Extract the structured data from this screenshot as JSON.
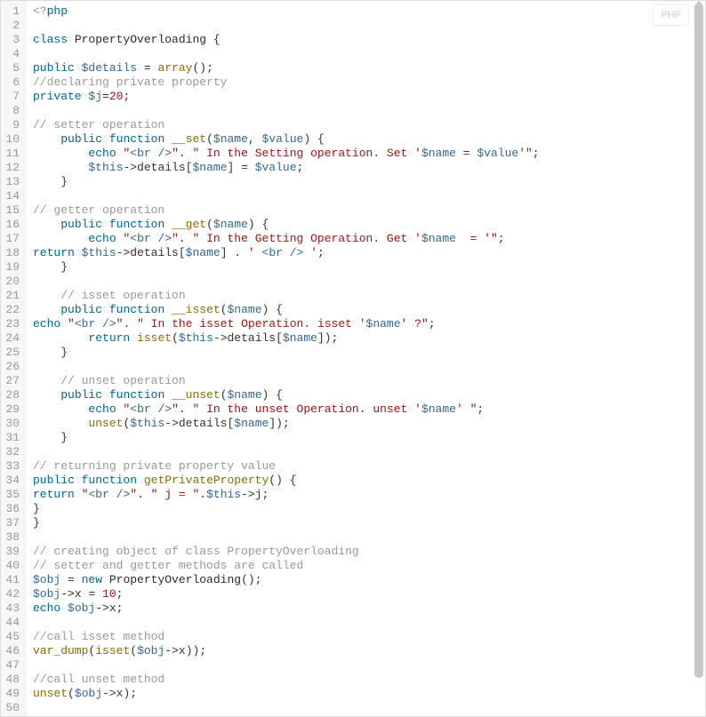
{
  "language_badge": "PHP",
  "line_count": 50,
  "code_lines": [
    [
      {
        "c": "tk-pre",
        "t": "<?"
      },
      {
        "c": "tk-kw",
        "t": "php"
      }
    ],
    [],
    [
      {
        "c": "tk-kw",
        "t": "class"
      },
      {
        "c": "",
        "t": " "
      },
      {
        "c": "tk-cls",
        "t": "PropertyOverloading"
      },
      {
        "c": "",
        "t": " {"
      }
    ],
    [],
    [
      {
        "c": "tk-kw",
        "t": "public"
      },
      {
        "c": "",
        "t": " "
      },
      {
        "c": "tk-var",
        "t": "$details"
      },
      {
        "c": "",
        "t": " = "
      },
      {
        "c": "tk-fn",
        "t": "array"
      },
      {
        "c": "",
        "t": "();"
      }
    ],
    [
      {
        "c": "tk-com",
        "t": "//declaring private property"
      }
    ],
    [
      {
        "c": "tk-kw",
        "t": "private"
      },
      {
        "c": "",
        "t": " "
      },
      {
        "c": "tk-var",
        "t": "$j"
      },
      {
        "c": "",
        "t": "="
      },
      {
        "c": "tk-num",
        "t": "20"
      },
      {
        "c": "",
        "t": ";"
      }
    ],
    [],
    [
      {
        "c": "tk-com",
        "t": "// setter operation"
      }
    ],
    [
      {
        "c": "",
        "t": "    "
      },
      {
        "c": "tk-kw",
        "t": "public"
      },
      {
        "c": "",
        "t": " "
      },
      {
        "c": "tk-kw",
        "t": "function"
      },
      {
        "c": "",
        "t": " "
      },
      {
        "c": "tk-fn",
        "t": "__set"
      },
      {
        "c": "",
        "t": "("
      },
      {
        "c": "tk-var",
        "t": "$name"
      },
      {
        "c": "",
        "t": ", "
      },
      {
        "c": "tk-var",
        "t": "$value"
      },
      {
        "c": "",
        "t": ") {"
      }
    ],
    [
      {
        "c": "",
        "t": "        "
      },
      {
        "c": "tk-kw",
        "t": "echo"
      },
      {
        "c": "",
        "t": " "
      },
      {
        "c": "tk-str",
        "t": "\""
      },
      {
        "c": "tk-tag",
        "t": "<br />"
      },
      {
        "c": "tk-str",
        "t": "\""
      },
      {
        "c": "",
        "t": ". "
      },
      {
        "c": "tk-str",
        "t": "\" In the Setting operation. Set '"
      },
      {
        "c": "tk-var",
        "t": "$name"
      },
      {
        "c": "tk-str",
        "t": " = "
      },
      {
        "c": "tk-var",
        "t": "$value"
      },
      {
        "c": "tk-str",
        "t": "'\""
      },
      {
        "c": "",
        "t": ";"
      }
    ],
    [
      {
        "c": "",
        "t": "        "
      },
      {
        "c": "tk-var",
        "t": "$this"
      },
      {
        "c": "",
        "t": "->"
      },
      {
        "c": "tk-prop",
        "t": "details"
      },
      {
        "c": "",
        "t": "["
      },
      {
        "c": "tk-var",
        "t": "$name"
      },
      {
        "c": "",
        "t": "] = "
      },
      {
        "c": "tk-var",
        "t": "$value"
      },
      {
        "c": "",
        "t": ";"
      }
    ],
    [
      {
        "c": "",
        "t": "    }"
      }
    ],
    [],
    [
      {
        "c": "tk-com",
        "t": "// getter operation"
      }
    ],
    [
      {
        "c": "",
        "t": "    "
      },
      {
        "c": "tk-kw",
        "t": "public"
      },
      {
        "c": "",
        "t": " "
      },
      {
        "c": "tk-kw",
        "t": "function"
      },
      {
        "c": "",
        "t": " "
      },
      {
        "c": "tk-fn",
        "t": "__get"
      },
      {
        "c": "",
        "t": "("
      },
      {
        "c": "tk-var",
        "t": "$name"
      },
      {
        "c": "",
        "t": ") {"
      }
    ],
    [
      {
        "c": "",
        "t": "        "
      },
      {
        "c": "tk-kw",
        "t": "echo"
      },
      {
        "c": "",
        "t": " "
      },
      {
        "c": "tk-str",
        "t": "\""
      },
      {
        "c": "tk-tag",
        "t": "<br />"
      },
      {
        "c": "tk-str",
        "t": "\""
      },
      {
        "c": "",
        "t": ". "
      },
      {
        "c": "tk-str",
        "t": "\" In the Getting Operation. Get '"
      },
      {
        "c": "tk-var",
        "t": "$name"
      },
      {
        "c": "tk-str",
        "t": "  = '\""
      },
      {
        "c": "",
        "t": ";"
      }
    ],
    [
      {
        "c": "tk-kw",
        "t": "return"
      },
      {
        "c": "",
        "t": " "
      },
      {
        "c": "tk-var",
        "t": "$this"
      },
      {
        "c": "",
        "t": "->"
      },
      {
        "c": "tk-prop",
        "t": "details"
      },
      {
        "c": "",
        "t": "["
      },
      {
        "c": "tk-var",
        "t": "$name"
      },
      {
        "c": "",
        "t": "] . "
      },
      {
        "c": "tk-str",
        "t": "' "
      },
      {
        "c": "tk-tag",
        "t": "<br />"
      },
      {
        "c": "tk-str",
        "t": " '"
      },
      {
        "c": "",
        "t": ";"
      }
    ],
    [
      {
        "c": "",
        "t": "    }"
      }
    ],
    [],
    [
      {
        "c": "",
        "t": "    "
      },
      {
        "c": "tk-com",
        "t": "// isset operation"
      }
    ],
    [
      {
        "c": "",
        "t": "    "
      },
      {
        "c": "tk-kw",
        "t": "public"
      },
      {
        "c": "",
        "t": " "
      },
      {
        "c": "tk-kw",
        "t": "function"
      },
      {
        "c": "",
        "t": " "
      },
      {
        "c": "tk-fn",
        "t": "__isset"
      },
      {
        "c": "",
        "t": "("
      },
      {
        "c": "tk-var",
        "t": "$name"
      },
      {
        "c": "",
        "t": ") {"
      }
    ],
    [
      {
        "c": "tk-kw",
        "t": "echo"
      },
      {
        "c": "",
        "t": " "
      },
      {
        "c": "tk-str",
        "t": "\""
      },
      {
        "c": "tk-tag",
        "t": "<br />"
      },
      {
        "c": "tk-str",
        "t": "\""
      },
      {
        "c": "",
        "t": ". "
      },
      {
        "c": "tk-str",
        "t": "\" In the isset Operation. isset '"
      },
      {
        "c": "tk-var",
        "t": "$name"
      },
      {
        "c": "tk-str",
        "t": "' ?\""
      },
      {
        "c": "",
        "t": ";"
      }
    ],
    [
      {
        "c": "",
        "t": "        "
      },
      {
        "c": "tk-kw",
        "t": "return"
      },
      {
        "c": "",
        "t": " "
      },
      {
        "c": "tk-fn",
        "t": "isset"
      },
      {
        "c": "",
        "t": "("
      },
      {
        "c": "tk-var",
        "t": "$this"
      },
      {
        "c": "",
        "t": "->"
      },
      {
        "c": "tk-prop",
        "t": "details"
      },
      {
        "c": "",
        "t": "["
      },
      {
        "c": "tk-var",
        "t": "$name"
      },
      {
        "c": "",
        "t": "]);"
      }
    ],
    [
      {
        "c": "",
        "t": "    }"
      }
    ],
    [],
    [
      {
        "c": "",
        "t": "    "
      },
      {
        "c": "tk-com",
        "t": "// unset operation"
      }
    ],
    [
      {
        "c": "",
        "t": "    "
      },
      {
        "c": "tk-kw",
        "t": "public"
      },
      {
        "c": "",
        "t": " "
      },
      {
        "c": "tk-kw",
        "t": "function"
      },
      {
        "c": "",
        "t": " "
      },
      {
        "c": "tk-fn",
        "t": "__unset"
      },
      {
        "c": "",
        "t": "("
      },
      {
        "c": "tk-var",
        "t": "$name"
      },
      {
        "c": "",
        "t": ") {"
      }
    ],
    [
      {
        "c": "",
        "t": "        "
      },
      {
        "c": "tk-kw",
        "t": "echo"
      },
      {
        "c": "",
        "t": " "
      },
      {
        "c": "tk-str",
        "t": "\""
      },
      {
        "c": "tk-tag",
        "t": "<br />"
      },
      {
        "c": "tk-str",
        "t": "\""
      },
      {
        "c": "",
        "t": ". "
      },
      {
        "c": "tk-str",
        "t": "\" In the unset Operation. unset '"
      },
      {
        "c": "tk-var",
        "t": "$name"
      },
      {
        "c": "tk-str",
        "t": "' \""
      },
      {
        "c": "",
        "t": ";"
      }
    ],
    [
      {
        "c": "",
        "t": "        "
      },
      {
        "c": "tk-fn",
        "t": "unset"
      },
      {
        "c": "",
        "t": "("
      },
      {
        "c": "tk-var",
        "t": "$this"
      },
      {
        "c": "",
        "t": "->"
      },
      {
        "c": "tk-prop",
        "t": "details"
      },
      {
        "c": "",
        "t": "["
      },
      {
        "c": "tk-var",
        "t": "$name"
      },
      {
        "c": "",
        "t": "]);"
      }
    ],
    [
      {
        "c": "",
        "t": "    }"
      }
    ],
    [],
    [
      {
        "c": "tk-com",
        "t": "// returning private property value"
      }
    ],
    [
      {
        "c": "tk-kw",
        "t": "public"
      },
      {
        "c": "",
        "t": " "
      },
      {
        "c": "tk-kw",
        "t": "function"
      },
      {
        "c": "",
        "t": " "
      },
      {
        "c": "tk-fn",
        "t": "getPrivateProperty"
      },
      {
        "c": "",
        "t": "() {"
      }
    ],
    [
      {
        "c": "tk-kw",
        "t": "return"
      },
      {
        "c": "",
        "t": " "
      },
      {
        "c": "tk-str",
        "t": "\""
      },
      {
        "c": "tk-tag",
        "t": "<br />"
      },
      {
        "c": "tk-str",
        "t": "\""
      },
      {
        "c": "",
        "t": ". "
      },
      {
        "c": "tk-str",
        "t": "\" j = \""
      },
      {
        "c": "",
        "t": "."
      },
      {
        "c": "tk-var",
        "t": "$this"
      },
      {
        "c": "",
        "t": "->"
      },
      {
        "c": "tk-prop",
        "t": "j"
      },
      {
        "c": "",
        "t": ";"
      }
    ],
    [
      {
        "c": "",
        "t": "}"
      }
    ],
    [
      {
        "c": "",
        "t": "}"
      }
    ],
    [],
    [
      {
        "c": "tk-com",
        "t": "// creating object of class PropertyOverloading"
      }
    ],
    [
      {
        "c": "tk-com",
        "t": "// setter and getter methods are called"
      }
    ],
    [
      {
        "c": "tk-var",
        "t": "$obj"
      },
      {
        "c": "",
        "t": " = "
      },
      {
        "c": "tk-kw",
        "t": "new"
      },
      {
        "c": "",
        "t": " "
      },
      {
        "c": "tk-cls",
        "t": "PropertyOverloading"
      },
      {
        "c": "",
        "t": "();"
      }
    ],
    [
      {
        "c": "tk-var",
        "t": "$obj"
      },
      {
        "c": "",
        "t": "->"
      },
      {
        "c": "tk-prop",
        "t": "x"
      },
      {
        "c": "",
        "t": " = "
      },
      {
        "c": "tk-num",
        "t": "10"
      },
      {
        "c": "",
        "t": ";"
      }
    ],
    [
      {
        "c": "tk-kw",
        "t": "echo"
      },
      {
        "c": "",
        "t": " "
      },
      {
        "c": "tk-var",
        "t": "$obj"
      },
      {
        "c": "",
        "t": "->"
      },
      {
        "c": "tk-prop",
        "t": "x"
      },
      {
        "c": "",
        "t": ";"
      }
    ],
    [],
    [
      {
        "c": "tk-com",
        "t": "//call isset method"
      }
    ],
    [
      {
        "c": "tk-fn",
        "t": "var_dump"
      },
      {
        "c": "",
        "t": "("
      },
      {
        "c": "tk-fn",
        "t": "isset"
      },
      {
        "c": "",
        "t": "("
      },
      {
        "c": "tk-var",
        "t": "$obj"
      },
      {
        "c": "",
        "t": "->"
      },
      {
        "c": "tk-prop",
        "t": "x"
      },
      {
        "c": "",
        "t": "));"
      }
    ],
    [],
    [
      {
        "c": "tk-com",
        "t": "//call unset method"
      }
    ],
    [
      {
        "c": "tk-fn",
        "t": "unset"
      },
      {
        "c": "",
        "t": "("
      },
      {
        "c": "tk-var",
        "t": "$obj"
      },
      {
        "c": "",
        "t": "->"
      },
      {
        "c": "tk-prop",
        "t": "x"
      },
      {
        "c": "",
        "t": ");"
      }
    ],
    []
  ]
}
